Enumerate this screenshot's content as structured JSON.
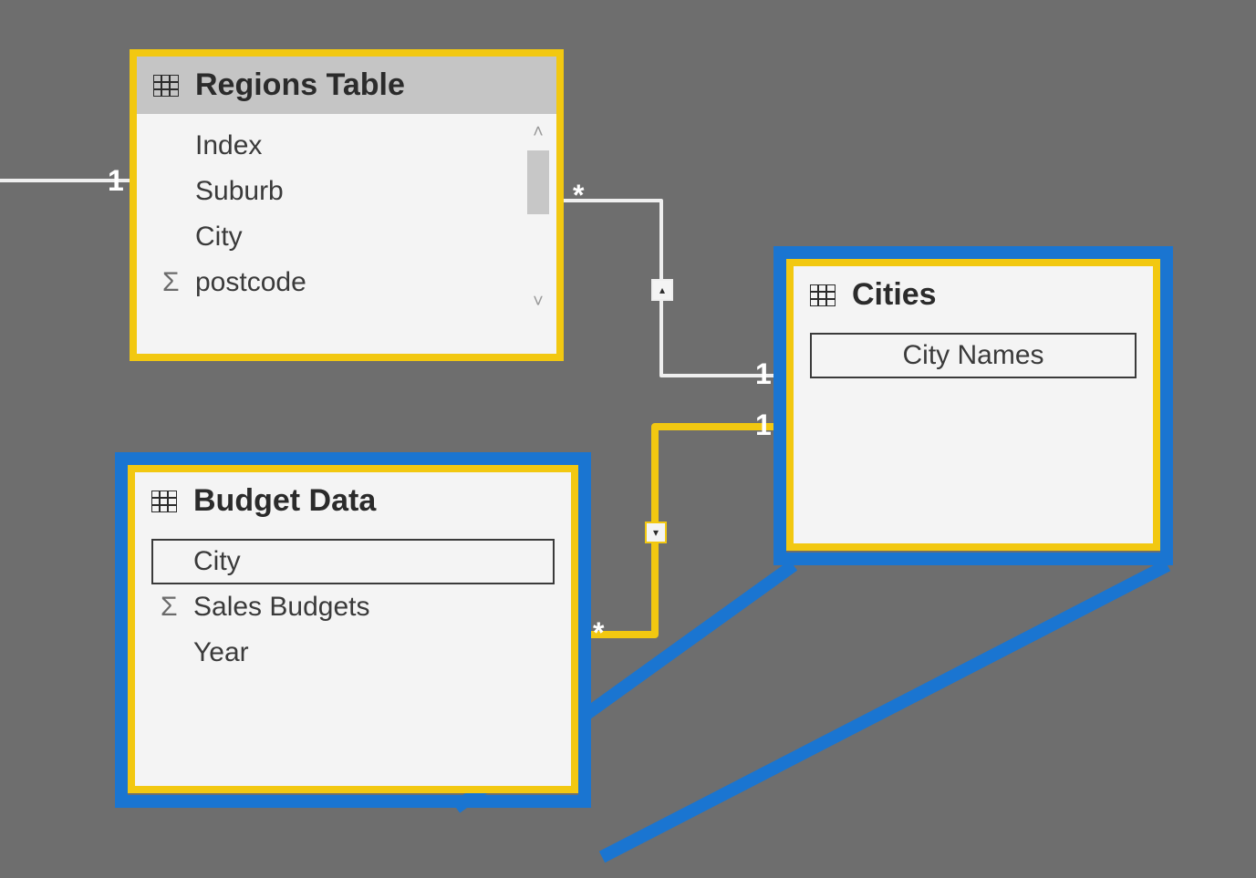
{
  "tables": {
    "regions": {
      "title": "Regions Table",
      "fields": {
        "index": {
          "label": "Index",
          "measure": false
        },
        "suburb": {
          "label": "Suburb",
          "measure": false
        },
        "city": {
          "label": "City",
          "measure": false
        },
        "postcode": {
          "label": "postcode",
          "measure": true
        }
      }
    },
    "budget": {
      "title": "Budget Data",
      "fields": {
        "city": {
          "label": "City",
          "measure": false,
          "selected": true
        },
        "budgets": {
          "label": "Sales Budgets",
          "measure": true
        },
        "year": {
          "label": "Year",
          "measure": false
        }
      }
    },
    "cities": {
      "title": "Cities",
      "fields": {
        "names": {
          "label": "City Names",
          "measure": false,
          "selected": true
        }
      }
    }
  },
  "relationships": {
    "left_to_regions": {
      "from_card": "1"
    },
    "regions_to_cities": {
      "from_card": "*",
      "to_card": "1",
      "direction": "single"
    },
    "cities_to_budget": {
      "from_card": "1",
      "to_card": "*",
      "direction": "single"
    }
  },
  "glyphs": {
    "sigma": "Σ",
    "chevron_up": "˄",
    "chevron_down": "˅",
    "arrow_up": "▴",
    "arrow_down": "▾"
  },
  "colors": {
    "canvas": "#6e6e6e",
    "selection_yellow": "#f2c811",
    "highlight_blue": "#1a75d1",
    "card_label": "#ffffff"
  }
}
